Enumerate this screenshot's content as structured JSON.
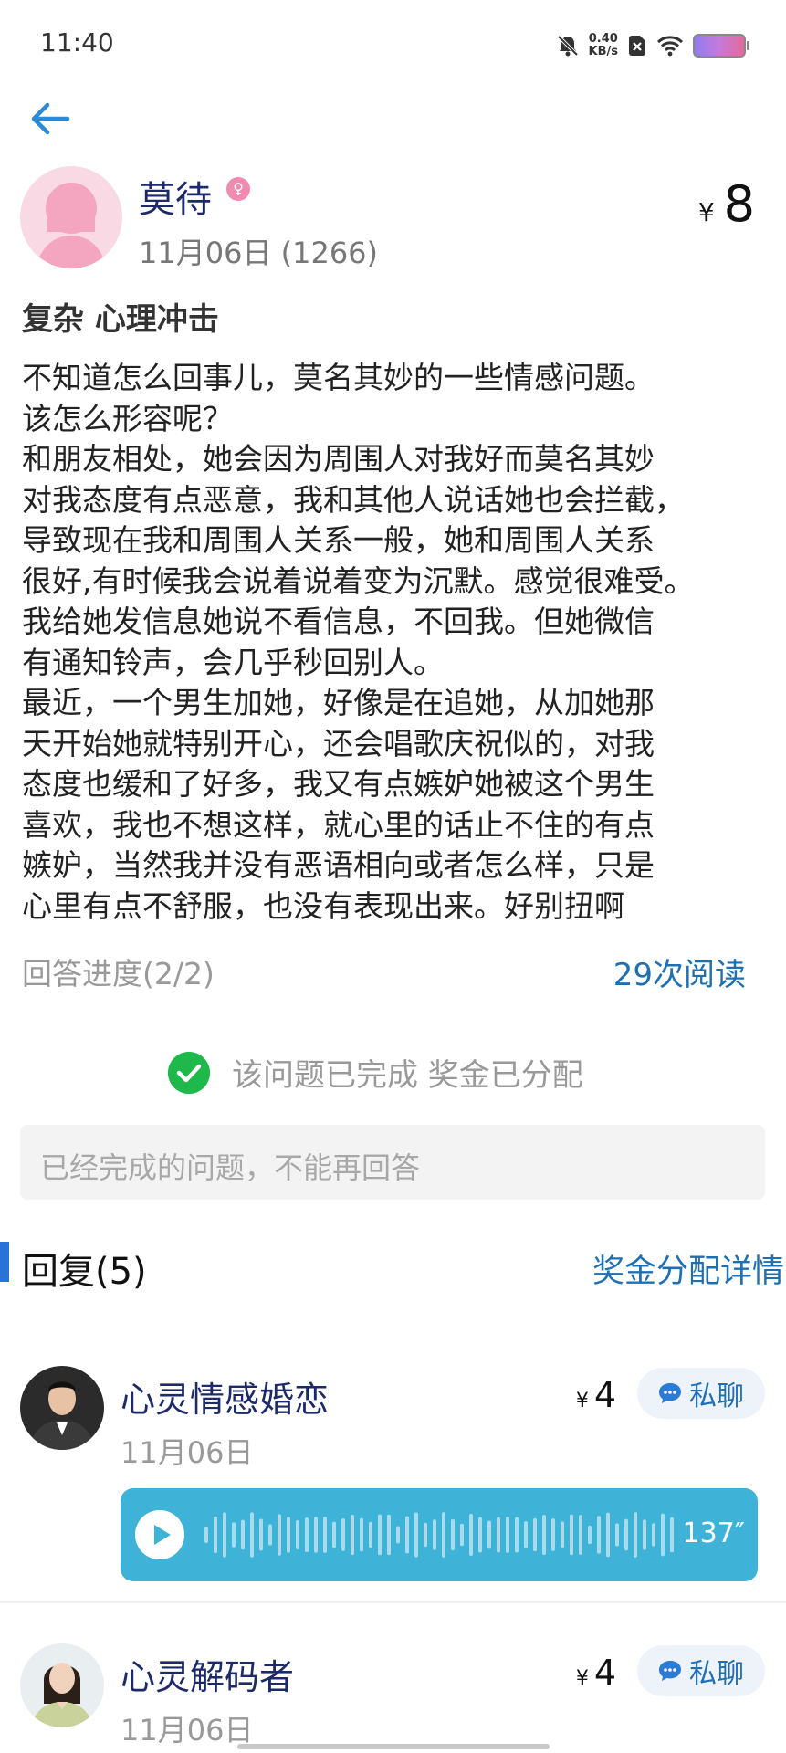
{
  "status": {
    "time": "11:40",
    "net_speed_value": "0.40",
    "net_speed_unit": "KB/s"
  },
  "question": {
    "asker_name": "莫待",
    "asker_meta": "11月06日 (1266)",
    "reward_symbol": "¥",
    "reward_amount": "8",
    "title": "复杂 心理冲击",
    "body_lines": [
      "不知道怎么回事儿，莫名其妙的一些情感问题。",
      "该怎么形容呢？",
      "和朋友相处，她会因为周围人对我好而莫名其妙",
      "对我态度有点恶意，我和其他人说话她也会拦截，",
      "导致现在我和周围人关系一般，她和周围人关系",
      "很好,有时候我会说着说着变为沉默。感觉很难受。",
      "我给她发信息她说不看信息，不回我。但她微信",
      "有通知铃声，会几乎秒回别人。",
      "最近，一个男生加她，好像是在追她，从加她那",
      "天开始她就特别开心，还会唱歌庆祝似的，对我",
      "态度也缓和了好多，我又有点嫉妒她被这个男生",
      "喜欢，我也不想这样，就心里的话止不住的有点",
      "嫉妒，当然我并没有恶语相向或者怎么样，只是",
      "心里有点不舒服，也没有表现出来。好别扭啊"
    ],
    "progress": "回答进度(2/2)",
    "reads": "29次阅读",
    "completed_text": "该问题已完成 奖金已分配",
    "closed_placeholder": "已经完成的问题，不能再回答"
  },
  "replies": {
    "title": "回复(5)",
    "bonus_detail": "奖金分配详情",
    "items": [
      {
        "name": "心灵情感婚恋",
        "date": "11月06日",
        "reward_symbol": "¥",
        "reward": "4",
        "chat_label": "私聊",
        "voice_duration": "137″",
        "avatar_icon": "avatar-man-suit"
      },
      {
        "name": "心灵解码者",
        "date": "11月06日",
        "reward_symbol": "¥",
        "reward": "4",
        "chat_label": "私聊",
        "avatar_icon": "avatar-woman"
      }
    ]
  },
  "colors": {
    "link": "#1f6fb3",
    "name": "#1c2a6a",
    "voice_bg": "#3fb2d8",
    "check": "#1fb84a",
    "accent_bar": "#2a73d6"
  }
}
